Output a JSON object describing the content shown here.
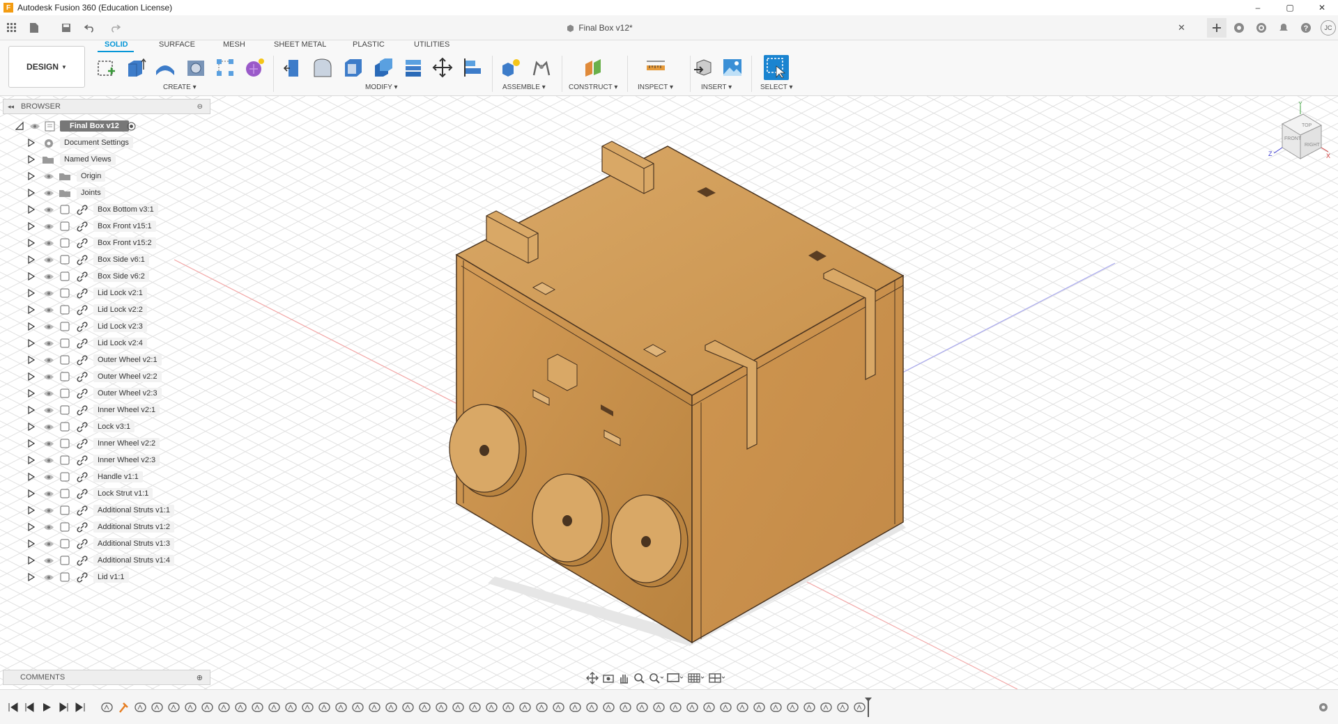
{
  "window": {
    "title": "Autodesk Fusion 360 (Education License)",
    "logo": "F",
    "min": "–",
    "max": "▢",
    "close": "✕"
  },
  "document": {
    "tab_title": "Final Box v12*",
    "close": "✕"
  },
  "quick_access": {
    "grid_icon": "⋮⋮⋮",
    "file_icon": "▤",
    "save_icon": "💾",
    "undo_icon": "↶",
    "redo_icon": "↷"
  },
  "user": {
    "initials": "JC"
  },
  "ribbon": {
    "design_label": "DESIGN",
    "tabs": [
      "SOLID",
      "SURFACE",
      "MESH",
      "SHEET METAL",
      "PLASTIC",
      "UTILITIES"
    ],
    "groups": [
      "CREATE",
      "MODIFY",
      "ASSEMBLE",
      "CONSTRUCT",
      "INSPECT",
      "INSERT",
      "SELECT"
    ]
  },
  "browser": {
    "title": "BROWSER",
    "root": "Final Box v12",
    "folders": [
      "Document Settings",
      "Named Views",
      "Origin",
      "Joints"
    ],
    "components": [
      "Box Bottom v3:1",
      "Box Front v15:1",
      "Box Front v15:2",
      "Box Side v6:1",
      "Box Side v6:2",
      "Lid Lock v2:1",
      "Lid Lock v2:2",
      "Lid Lock v2:3",
      "Lid Lock v2:4",
      "Outer Wheel v2:1",
      "Outer Wheel v2:2",
      "Outer Wheel v2:3",
      "Inner Wheel v2:1",
      "Lock v3:1",
      "Inner Wheel v2:2",
      "Inner Wheel v2:3",
      "Handle v1:1",
      "Lock Strut v1:1",
      "Additional Struts v1:1",
      "Additional Struts v1:2",
      "Additional Struts v1:3",
      "Additional Struts v1:4",
      "Lid v1:1"
    ]
  },
  "comments": {
    "title": "COMMENTS"
  },
  "viewcube": {
    "top": "TOP",
    "front": "FRONT",
    "right": "RIGHT",
    "x": "X",
    "y": "Y",
    "z": "Z"
  },
  "colors": {
    "accent": "#0696d7",
    "wood": "#d6a25a",
    "grid": "#dcdcdc"
  }
}
